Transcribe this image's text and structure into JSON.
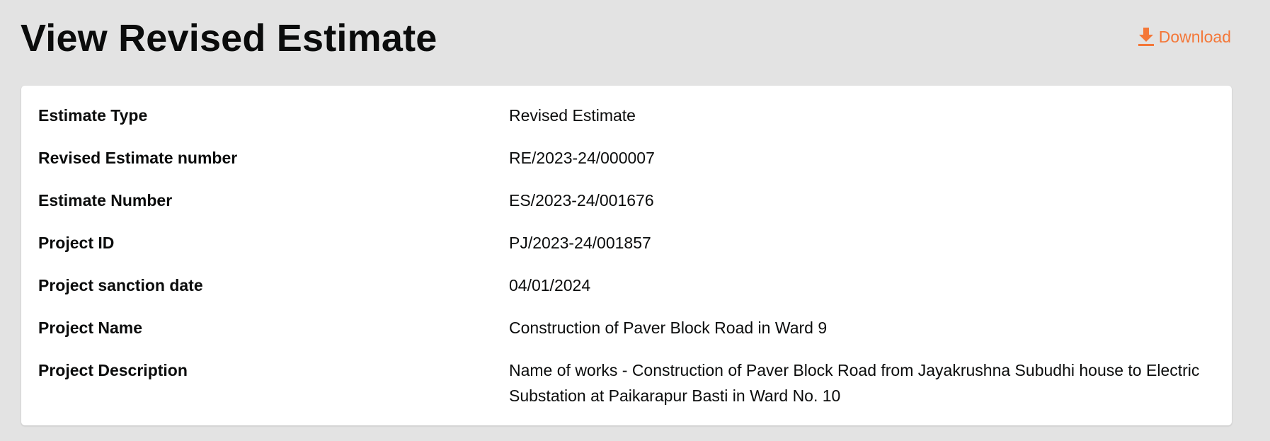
{
  "header": {
    "title": "View Revised Estimate",
    "download_label": "Download",
    "download_icon": "download-icon",
    "accent_color": "#f47738"
  },
  "details": {
    "rows": [
      {
        "label": "Estimate Type",
        "value": "Revised Estimate"
      },
      {
        "label": "Revised Estimate number",
        "value": "RE/2023-24/000007"
      },
      {
        "label": "Estimate Number",
        "value": "ES/2023-24/001676"
      },
      {
        "label": "Project ID",
        "value": "PJ/2023-24/001857"
      },
      {
        "label": "Project sanction date",
        "value": "04/01/2024"
      },
      {
        "label": "Project Name",
        "value": "Construction of Paver Block Road in Ward 9"
      },
      {
        "label": "Project Description",
        "value": "Name of works - Construction of Paver Block Road from Jayakrushna Subudhi house to Electric Substation at Paikarapur Basti in Ward No. 10"
      }
    ]
  }
}
